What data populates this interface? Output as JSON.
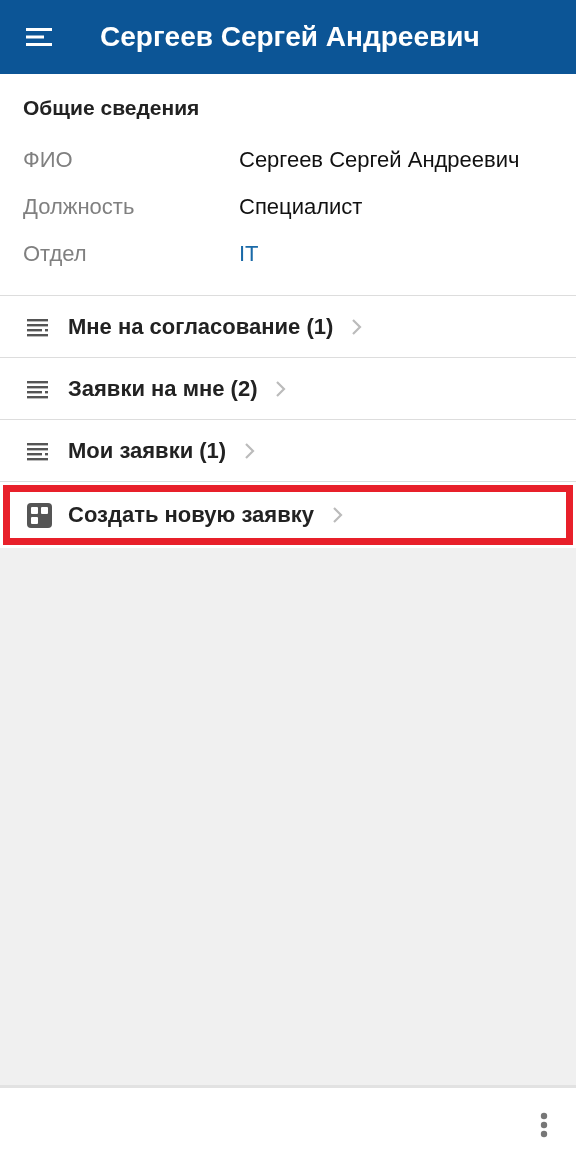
{
  "header": {
    "title": "Сергеев Сергей Андреевич"
  },
  "info": {
    "heading": "Общие сведения",
    "fields": [
      {
        "label": "ФИО",
        "value": "Сергеев Сергей Андреевич",
        "kind": "text"
      },
      {
        "label": "Должность",
        "value": "Специалист",
        "kind": "text"
      },
      {
        "label": "Отдел",
        "value": "IT",
        "kind": "link"
      }
    ]
  },
  "menu": [
    {
      "label": "Мне на согласование (1)",
      "kind": "list",
      "highlighted": false
    },
    {
      "label": "Заявки на мне (2)",
      "kind": "list",
      "highlighted": false
    },
    {
      "label": "Мои заявки (1)",
      "kind": "list",
      "highlighted": false
    },
    {
      "label": "Создать новую заявку",
      "kind": "grid",
      "highlighted": true
    }
  ]
}
